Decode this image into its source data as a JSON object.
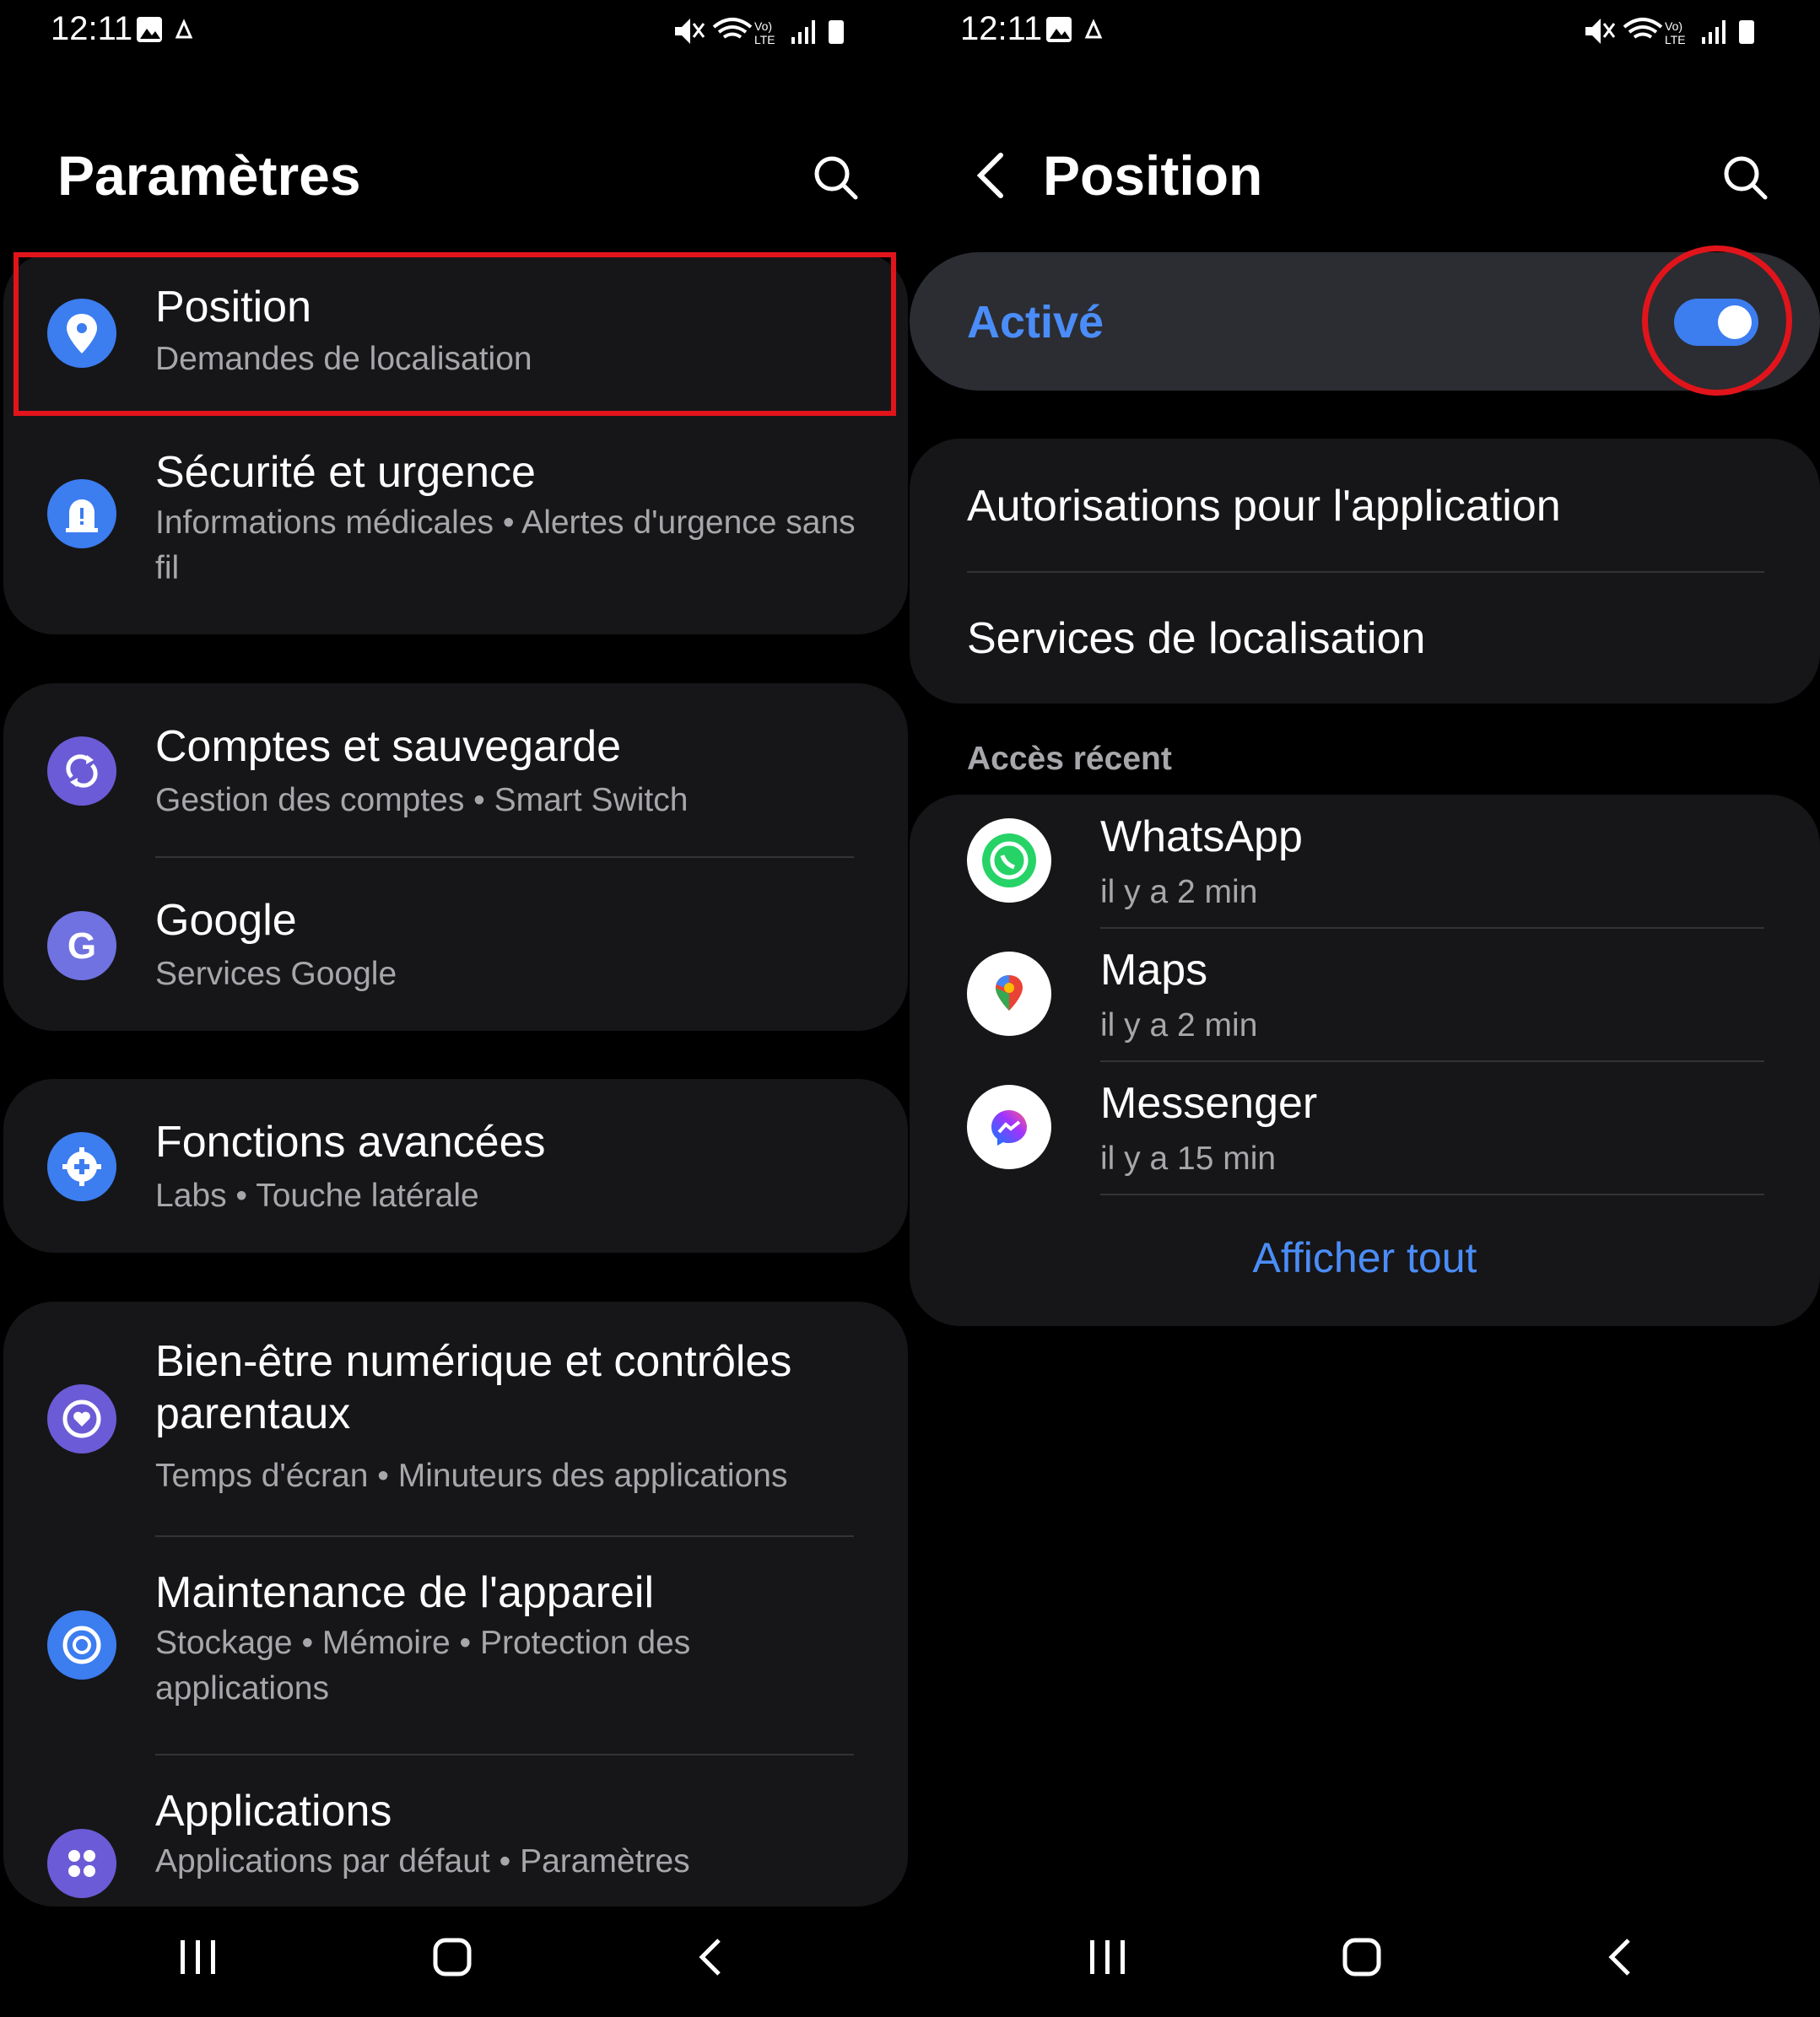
{
  "status_bar": {
    "time": "12:11"
  },
  "left": {
    "title": "Paramètres",
    "items": [
      {
        "title": "Position",
        "sub": "Demandes de localisation",
        "icon": "location-pin-icon",
        "color": "#3c7df0"
      },
      {
        "title": "Sécurité et urgence",
        "sub": "Informations médicales  •  Alertes d'urgence sans fil",
        "icon": "alert-bell-icon",
        "color": "#3c7df0"
      },
      {
        "title": "Comptes et sauvegarde",
        "sub": "Gestion des comptes  •  Smart Switch",
        "icon": "sync-icon",
        "color": "#6b5bd6"
      },
      {
        "title": "Google",
        "sub": "Services Google",
        "icon": "google-icon",
        "color": "#6f72e0"
      },
      {
        "title": "Fonctions avancées",
        "sub": "Labs  •  Touche latérale",
        "icon": "gear-plus-icon",
        "color": "#3c7df0"
      },
      {
        "title": "Bien-être numérique et contrôles parentaux",
        "sub": "Temps d'écran  •  Minuteurs des applications",
        "icon": "heart-circle-icon",
        "color": "#6b5bd6"
      },
      {
        "title": "Maintenance de l'appareil",
        "sub": "Stockage  •  Mémoire  •  Protection des applications",
        "icon": "device-care-icon",
        "color": "#3c7df0"
      },
      {
        "title": "Applications",
        "sub": "Applications par défaut  •  Paramètres",
        "icon": "apps-grid-icon",
        "color": "#6b5bd6"
      }
    ]
  },
  "right": {
    "title": "Position",
    "toggle_label": "Activé",
    "toggle_on": true,
    "menu": [
      {
        "label": "Autorisations pour l'application"
      },
      {
        "label": "Services de localisation"
      }
    ],
    "recent_header": "Accès récent",
    "recent": [
      {
        "name": "WhatsApp",
        "time": "il y a 2 min",
        "icon": "whatsapp-icon"
      },
      {
        "name": "Maps",
        "time": "il y a 2 min",
        "icon": "maps-icon"
      },
      {
        "name": "Messenger",
        "time": "il y a 15 min",
        "icon": "messenger-icon"
      }
    ],
    "show_all": "Afficher tout"
  },
  "colors": {
    "accent": "#4b8df8",
    "highlight": "#e2141b",
    "card": "#161618"
  }
}
